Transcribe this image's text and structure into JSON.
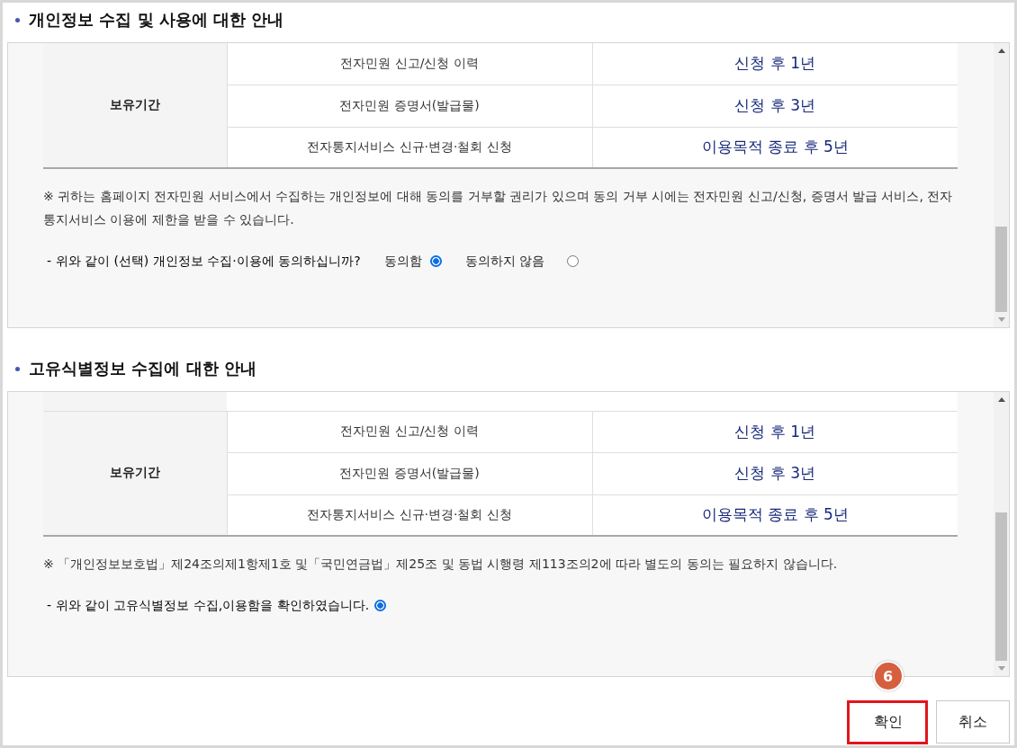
{
  "sections": [
    {
      "title": "개인정보 수집 및 사용에 대한 안내",
      "table": {
        "clipped_row_above": false,
        "header": "보유기간",
        "rows": [
          {
            "item": "전자민원 신고/신청 이력",
            "period": "신청 후 1년"
          },
          {
            "item": "전자민원 증명서(발급물)",
            "period": "신청 후 3년"
          },
          {
            "item": "전자통지서비스 신규·변경·철회 신청",
            "period": "이용목적 종료 후 5년"
          }
        ]
      },
      "note": "※ 귀하는 홈페이지 전자민원 서비스에서 수집하는 개인정보에 대해 동의를 거부할 권리가 있으며 동의 거부 시에는 전자민원 신고/신청, 증명서 발급 서비스, 전자통지서비스 이용에 제한을 받을 수 있습니다.",
      "question": {
        "text": "- 위와 같이 (선택) 개인정보 수집·이용에 동의하십니까?",
        "options": [
          {
            "label": "동의함",
            "selected": true
          },
          {
            "label": "동의하지 않음",
            "selected": false
          }
        ]
      }
    },
    {
      "title": "고유식별정보 수집에 대한 안내",
      "table": {
        "clipped_row_above": true,
        "header": "보유기간",
        "rows": [
          {
            "item": "전자민원 신고/신청 이력",
            "period": "신청 후 1년"
          },
          {
            "item": "전자민원 증명서(발급물)",
            "period": "신청 후 3년"
          },
          {
            "item": "전자통지서비스 신규·변경·철회 신청",
            "period": "이용목적 종료 후 5년"
          }
        ]
      },
      "note": "※ 「개인정보보호법」제24조의제1항제1호 및「국민연금법」제25조 및 동법 시행령 제113조의2에 따라 별도의 동의는 필요하지 않습니다.",
      "question": {
        "text": "- 위와 같이 고유식별정보 수집,이용함을 확인하였습니다.",
        "options": [
          {
            "selected": true
          }
        ]
      }
    }
  ],
  "buttons": [
    {
      "label": "확인",
      "highlighted": true,
      "step_badge": "6"
    },
    {
      "label": "취소",
      "highlighted": false
    }
  ]
}
